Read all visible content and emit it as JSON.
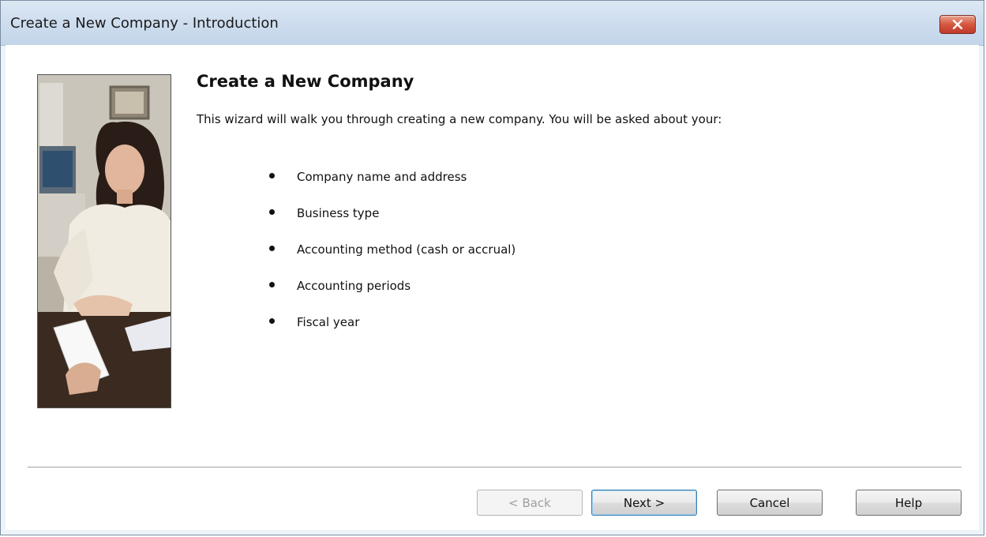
{
  "window": {
    "title": "Create a New Company - Introduction"
  },
  "content": {
    "heading": "Create a New Company",
    "intro": "This wizard will walk you through creating a new company.  You will be asked about your:",
    "bullets": [
      "Company name and address",
      "Business type",
      "Accounting method (cash or accrual)",
      "Accounting periods",
      "Fiscal year"
    ]
  },
  "buttons": {
    "back": "< Back",
    "next": "Next >",
    "cancel": "Cancel",
    "help": "Help"
  },
  "icons": {
    "close": "close-icon",
    "photo": "businesswoman-photo"
  },
  "colors": {
    "titlebar": "#cfdeef",
    "close_button": "#c0392b",
    "client_background": "#ffffff",
    "disabled_text": "#a0a0a0"
  }
}
